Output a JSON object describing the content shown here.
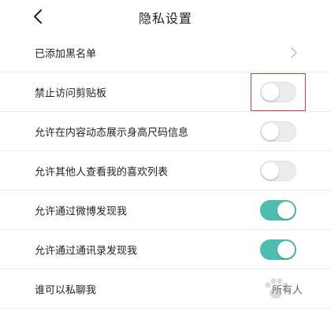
{
  "header": {
    "title": "隐私设置"
  },
  "rows": [
    {
      "label": "已添加黑名单",
      "type": "link"
    },
    {
      "label": "禁止访问剪贴板",
      "type": "toggle",
      "on": false
    },
    {
      "label": "允许在内容动态展示身高尺码信息",
      "type": "toggle",
      "on": false
    },
    {
      "label": "允许其他人查看我的喜欢列表",
      "type": "toggle",
      "on": false
    },
    {
      "label": "允许通过微博发现我",
      "type": "toggle",
      "on": true
    },
    {
      "label": "允许通过通讯录发现我",
      "type": "toggle",
      "on": true
    },
    {
      "label": "谁可以私聊我",
      "type": "value",
      "value": "所有人"
    }
  ],
  "colors": {
    "toggle_on": "#4dbdb0",
    "toggle_off": "#ececec",
    "highlight": "#e23c3c"
  }
}
